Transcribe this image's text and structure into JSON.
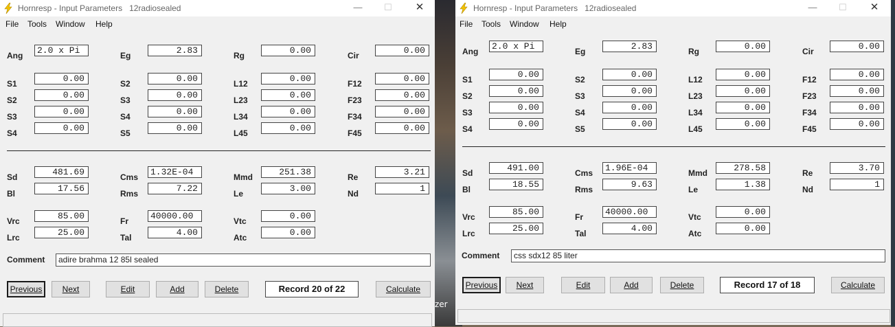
{
  "background": {
    "partial_text": "zer"
  },
  "windows": [
    {
      "title": "Hornresp - Input Parameters   12radiosealed",
      "menu": [
        "File",
        "Tools",
        "Window",
        "Help"
      ],
      "controls": {
        "minimize": "—",
        "maximize": "☐",
        "close": "✕"
      },
      "top_fields": [
        {
          "label": "Ang",
          "value": "2.0 x Pi",
          "align": "left"
        },
        {
          "label": "Eg",
          "value": "2.83"
        },
        {
          "label": "Rg",
          "value": "0.00"
        },
        {
          "label": "Cir",
          "value": "0.00"
        }
      ],
      "horn_rows": [
        [
          {
            "label": "S1",
            "value": "0.00"
          },
          {
            "label": "S2",
            "value": "0.00"
          },
          {
            "label": "L12",
            "value": "0.00"
          },
          {
            "label": "F12",
            "value": "0.00"
          }
        ],
        [
          {
            "label": "S2",
            "value": "0.00"
          },
          {
            "label": "S3",
            "value": "0.00"
          },
          {
            "label": "L23",
            "value": "0.00"
          },
          {
            "label": "F23",
            "value": "0.00"
          }
        ],
        [
          {
            "label": "S3",
            "value": "0.00"
          },
          {
            "label": "S4",
            "value": "0.00"
          },
          {
            "label": "L34",
            "value": "0.00"
          },
          {
            "label": "F34",
            "value": "0.00"
          }
        ],
        [
          {
            "label": "S4",
            "value": "0.00"
          },
          {
            "label": "S5",
            "value": "0.00"
          },
          {
            "label": "L45",
            "value": "0.00"
          },
          {
            "label": "F45",
            "value": "0.00"
          }
        ]
      ],
      "driver_rows": [
        [
          {
            "label": "Sd",
            "value": "481.69"
          },
          {
            "label": "Cms",
            "value": "1.32E-04",
            "align": "left"
          },
          {
            "label": "Mmd",
            "value": "251.38"
          },
          {
            "label": "Re",
            "value": "3.21"
          }
        ],
        [
          {
            "label": "Bl",
            "value": "17.56"
          },
          {
            "label": "Rms",
            "value": "7.22"
          },
          {
            "label": "Le",
            "value": "3.00"
          },
          {
            "label": "Nd",
            "value": "1"
          }
        ]
      ],
      "chamber_rows": [
        [
          {
            "label": "Vrc",
            "value": "85.00"
          },
          {
            "label": "Fr",
            "value": "40000.00",
            "align": "left"
          },
          {
            "label": "Vtc",
            "value": "0.00"
          }
        ],
        [
          {
            "label": "Lrc",
            "value": "25.00"
          },
          {
            "label": "Tal",
            "value": "4.00"
          },
          {
            "label": "Atc",
            "value": "0.00"
          }
        ]
      ],
      "comment_label": "Comment",
      "comment": "adire brahma 12 85l sealed",
      "buttons": [
        "Previous",
        "Next",
        "Edit",
        "Add",
        "Delete",
        "Calculate"
      ],
      "record": "Record 20 of 22"
    },
    {
      "title": "Hornresp - Input Parameters   12radiosealed",
      "menu": [
        "File",
        "Tools",
        "Window",
        "Help"
      ],
      "controls": {
        "minimize": "—",
        "maximize": "☐",
        "close": "✕"
      },
      "top_fields": [
        {
          "label": "Ang",
          "value": "2.0 x Pi",
          "align": "left"
        },
        {
          "label": "Eg",
          "value": "2.83"
        },
        {
          "label": "Rg",
          "value": "0.00"
        },
        {
          "label": "Cir",
          "value": "0.00"
        }
      ],
      "horn_rows": [
        [
          {
            "label": "S1",
            "value": "0.00"
          },
          {
            "label": "S2",
            "value": "0.00"
          },
          {
            "label": "L12",
            "value": "0.00"
          },
          {
            "label": "F12",
            "value": "0.00"
          }
        ],
        [
          {
            "label": "S2",
            "value": "0.00"
          },
          {
            "label": "S3",
            "value": "0.00"
          },
          {
            "label": "L23",
            "value": "0.00"
          },
          {
            "label": "F23",
            "value": "0.00"
          }
        ],
        [
          {
            "label": "S3",
            "value": "0.00"
          },
          {
            "label": "S4",
            "value": "0.00"
          },
          {
            "label": "L34",
            "value": "0.00"
          },
          {
            "label": "F34",
            "value": "0.00"
          }
        ],
        [
          {
            "label": "S4",
            "value": "0.00"
          },
          {
            "label": "S5",
            "value": "0.00"
          },
          {
            "label": "L45",
            "value": "0.00"
          },
          {
            "label": "F45",
            "value": "0.00"
          }
        ]
      ],
      "driver_rows": [
        [
          {
            "label": "Sd",
            "value": "491.00"
          },
          {
            "label": "Cms",
            "value": "1.96E-04",
            "align": "left"
          },
          {
            "label": "Mmd",
            "value": "278.58"
          },
          {
            "label": "Re",
            "value": "3.70"
          }
        ],
        [
          {
            "label": "Bl",
            "value": "18.55"
          },
          {
            "label": "Rms",
            "value": "9.63"
          },
          {
            "label": "Le",
            "value": "1.38"
          },
          {
            "label": "Nd",
            "value": "1"
          }
        ]
      ],
      "chamber_rows": [
        [
          {
            "label": "Vrc",
            "value": "85.00"
          },
          {
            "label": "Fr",
            "value": "40000.00",
            "align": "left"
          },
          {
            "label": "Vtc",
            "value": "0.00"
          }
        ],
        [
          {
            "label": "Lrc",
            "value": "25.00"
          },
          {
            "label": "Tal",
            "value": "4.00"
          },
          {
            "label": "Atc",
            "value": "0.00"
          }
        ]
      ],
      "comment_label": "Comment",
      "comment": "css sdx12 85 liter",
      "buttons": [
        "Previous",
        "Next",
        "Edit",
        "Add",
        "Delete",
        "Calculate"
      ],
      "record": "Record 17 of 18"
    }
  ]
}
